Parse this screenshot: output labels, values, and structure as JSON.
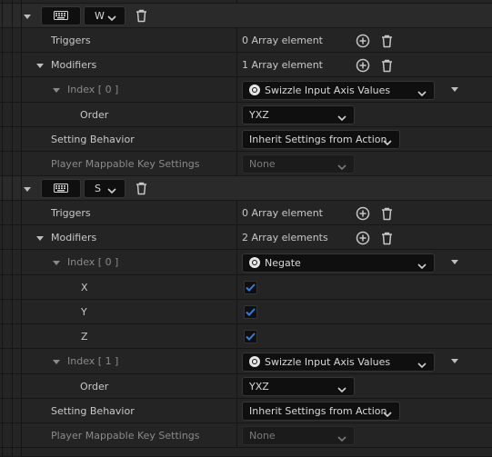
{
  "colors": {
    "background": "#242424",
    "header_row": "#2a2a2a",
    "field_bg": "#0f0f0f",
    "check_accent": "#2f7de1"
  },
  "mappings": [
    {
      "key": "W",
      "key_icon": "keyboard-icon",
      "triggers": {
        "label": "Triggers",
        "value": "0 Array element"
      },
      "modifiers": {
        "label": "Modifiers",
        "value": "1 Array element",
        "items": [
          {
            "index_label": "Index [ 0 ]",
            "type": "Swizzle Input Axis Values",
            "order_label": "Order",
            "order": "YXZ"
          }
        ]
      },
      "setting_behavior": {
        "label": "Setting Behavior",
        "value": "Inherit Settings from Action"
      },
      "player_mappable": {
        "label": "Player Mappable Key Settings",
        "value": "None"
      }
    },
    {
      "key": "S",
      "key_icon": "keyboard-icon",
      "triggers": {
        "label": "Triggers",
        "value": "0 Array element"
      },
      "modifiers": {
        "label": "Modifiers",
        "value": "2 Array elements",
        "items": [
          {
            "index_label": "Index [ 0 ]",
            "type": "Negate",
            "flags": [
              {
                "label": "X",
                "checked": true
              },
              {
                "label": "Y",
                "checked": true
              },
              {
                "label": "Z",
                "checked": true
              }
            ]
          },
          {
            "index_label": "Index [ 1 ]",
            "type": "Swizzle Input Axis Values",
            "order_label": "Order",
            "order": "YXZ"
          }
        ]
      },
      "setting_behavior": {
        "label": "Setting Behavior",
        "value": "Inherit Settings from Action"
      },
      "player_mappable": {
        "label": "Player Mappable Key Settings",
        "value": "None"
      }
    }
  ]
}
